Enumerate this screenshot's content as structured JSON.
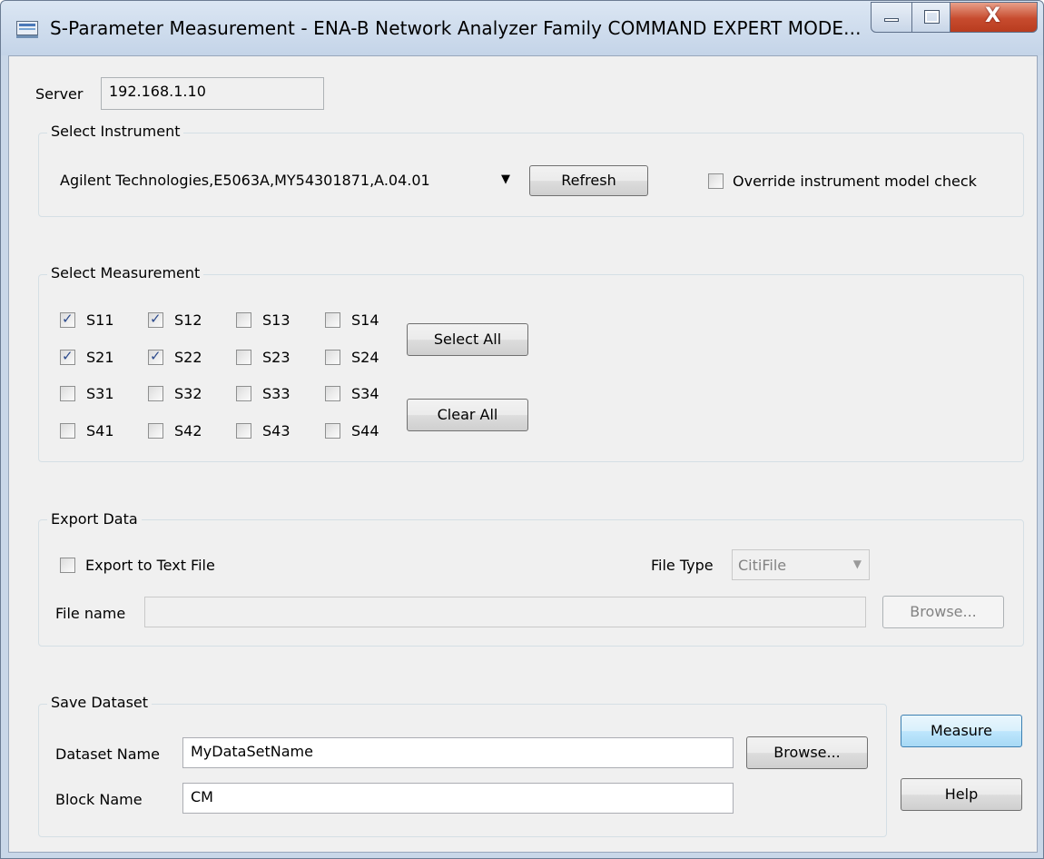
{
  "window": {
    "title": "S-Parameter Measurement - ENA-B Network Analyzer Family COMMAND EXPERT MODE...",
    "minimize_icon": "minimize-icon",
    "maximize_icon": "maximize-icon",
    "close_label": "X"
  },
  "server": {
    "label": "Server",
    "value": "192.168.1.10"
  },
  "select_instrument": {
    "title": "Select Instrument",
    "instrument_value": "Agilent Technologies,E5063A,MY54301871,A.04.01",
    "dropdown_icon": "chevron-down-icon",
    "refresh_label": "Refresh",
    "override_label": "Override instrument model check",
    "override_checked": false
  },
  "select_measurement": {
    "title": "Select Measurement",
    "params": [
      [
        {
          "label": "S11",
          "checked": true
        },
        {
          "label": "S12",
          "checked": true
        },
        {
          "label": "S13",
          "checked": false
        },
        {
          "label": "S14",
          "checked": false
        }
      ],
      [
        {
          "label": "S21",
          "checked": true
        },
        {
          "label": "S22",
          "checked": true
        },
        {
          "label": "S23",
          "checked": false
        },
        {
          "label": "S24",
          "checked": false
        }
      ],
      [
        {
          "label": "S31",
          "checked": false
        },
        {
          "label": "S32",
          "checked": false
        },
        {
          "label": "S33",
          "checked": false
        },
        {
          "label": "S34",
          "checked": false
        }
      ],
      [
        {
          "label": "S41",
          "checked": false
        },
        {
          "label": "S42",
          "checked": false
        },
        {
          "label": "S43",
          "checked": false
        },
        {
          "label": "S44",
          "checked": false
        }
      ]
    ],
    "select_all_label": "Select All",
    "clear_all_label": "Clear All"
  },
  "export_data": {
    "title": "Export Data",
    "export_label": "Export to Text File",
    "export_checked": false,
    "file_type_label": "File Type",
    "file_type_value": "CitiFile",
    "file_name_label": "File name",
    "file_name_value": "",
    "browse_label": "Browse..."
  },
  "save_dataset": {
    "title": "Save Dataset",
    "dataset_name_label": "Dataset Name",
    "dataset_name_value": "MyDataSetName",
    "block_name_label": "Block Name",
    "block_name_value": "CM",
    "browse_label": "Browse..."
  },
  "actions": {
    "measure_label": "Measure",
    "help_label": "Help"
  },
  "colors": {
    "title_bar": "#c4d4e8",
    "client_bg": "#f0f0f0",
    "close_button": "#c74b2e",
    "default_button_border": "#3c7fb1",
    "checkmark": "#2c4a8c"
  }
}
